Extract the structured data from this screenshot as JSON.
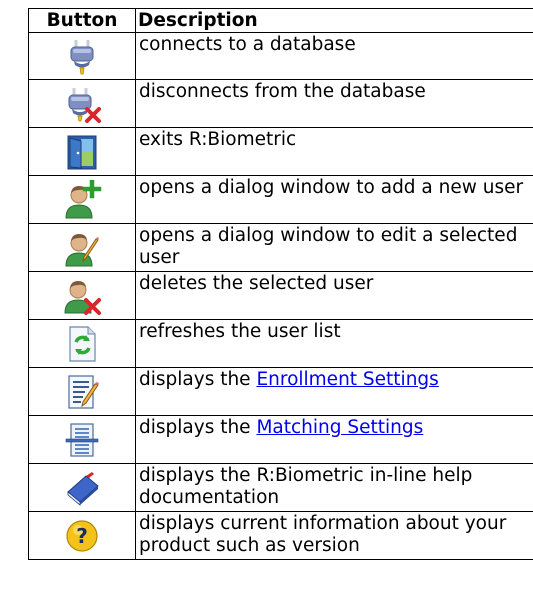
{
  "table": {
    "headers": {
      "button": "Button",
      "description": "Description"
    },
    "rows": [
      {
        "icon": "connect-plug-icon",
        "text": "connects to a database"
      },
      {
        "icon": "disconnect-plug-icon",
        "text": "disconnects from the database"
      },
      {
        "icon": "exit-door-icon",
        "text": "exits R:Biometric"
      },
      {
        "icon": "add-user-icon",
        "text": "opens a dialog window to add a new user"
      },
      {
        "icon": "edit-user-icon",
        "text": "οpens a dialog window to edit a selected user"
      },
      {
        "icon": "delete-user-icon",
        "text": "deletes the selected user"
      },
      {
        "icon": "refresh-icon",
        "text": "refreshes the user list"
      },
      {
        "icon": "enrollment-settings-icon",
        "prefix": "displays the ",
        "link": "Enrollment Settings"
      },
      {
        "icon": "matching-settings-icon",
        "prefix": "displays the ",
        "link": "Matching Settings"
      },
      {
        "icon": "help-book-icon",
        "text": "displays the R:Biometric in-line help documentation"
      },
      {
        "icon": "about-question-icon",
        "text": "displays current information about your product such as version"
      }
    ]
  },
  "colors": {
    "link": "#0000ee",
    "border": "#000000",
    "plug_blue": "#6f82b8",
    "delete_red": "#d8262b",
    "add_green": "#2f9c2f",
    "user_green": "#3f9a4a",
    "refresh_green": "#33a83a",
    "help_yellow": "#f4c21a"
  }
}
